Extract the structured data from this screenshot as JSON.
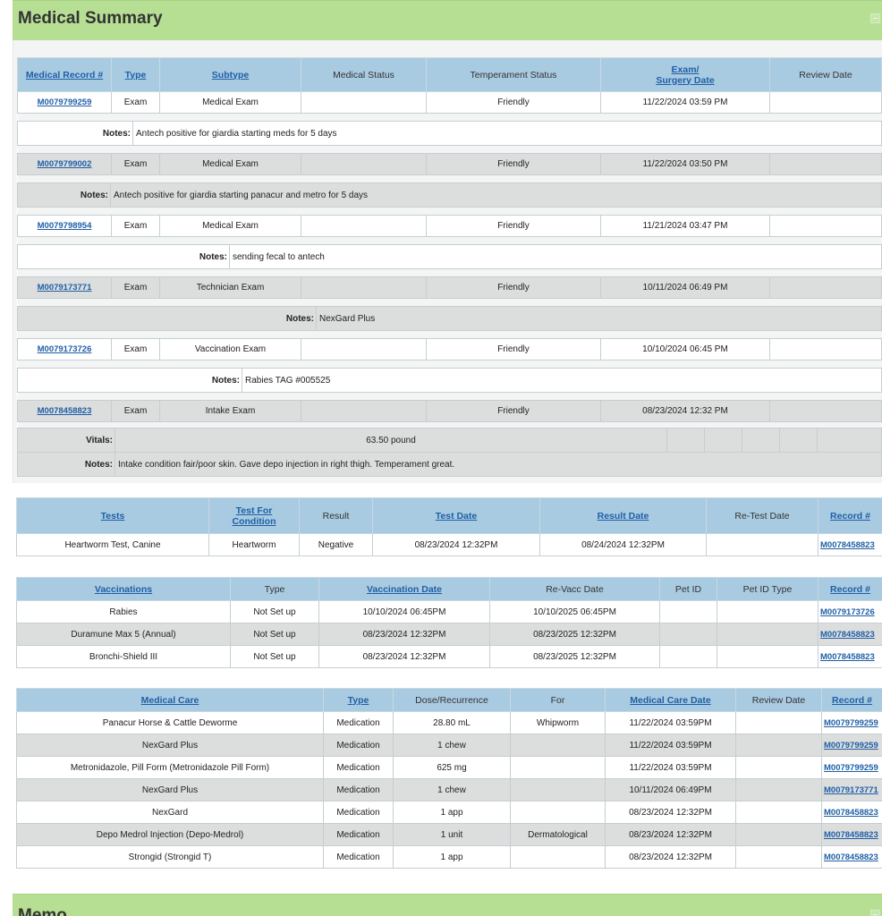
{
  "medical_summary": {
    "title": "Medical Summary",
    "headers": {
      "record": "Medical Record #",
      "type": "Type",
      "subtype": "Subtype",
      "medical_status": "Medical Status",
      "temperament_status": "Temperament Status",
      "exam_date_1": "Exam/",
      "exam_date_2": "Surgery Date",
      "review_date": "Review Date"
    },
    "notes_label": "Notes:",
    "vitals_label": "Vitals:",
    "records": [
      {
        "record": "M0079799259",
        "type": "Exam",
        "subtype": "Medical Exam",
        "medical_status": "",
        "temperament": "Friendly",
        "date": "11/22/2024 03:59 PM",
        "review": "",
        "notes": "Antech positive for giardia starting meds for 5 days"
      },
      {
        "record": "M0079799002",
        "type": "Exam",
        "subtype": "Medical Exam",
        "medical_status": "",
        "temperament": "Friendly",
        "date": "11/22/2024 03:50 PM",
        "review": "",
        "notes": "Antech positive for giardia starting panacur and metro for 5 days"
      },
      {
        "record": "M0079798954",
        "type": "Exam",
        "subtype": "Medical Exam",
        "medical_status": "",
        "temperament": "Friendly",
        "date": "11/21/2024 03:47 PM",
        "review": "",
        "notes": "sending fecal to antech"
      },
      {
        "record": "M0079173771",
        "type": "Exam",
        "subtype": "Technician Exam",
        "medical_status": "",
        "temperament": "Friendly",
        "date": "10/11/2024 06:49 PM",
        "review": "",
        "notes": "NexGard Plus"
      },
      {
        "record": "M0079173726",
        "type": "Exam",
        "subtype": "Vaccination Exam",
        "medical_status": "",
        "temperament": "Friendly",
        "date": "10/10/2024 06:45 PM",
        "review": "",
        "notes": "Rabies TAG #005525"
      },
      {
        "record": "M0078458823",
        "type": "Exam",
        "subtype": "Intake Exam",
        "medical_status": "",
        "temperament": "Friendly",
        "date": "08/23/2024 12:32 PM",
        "review": "",
        "vitals": "63.50 pound",
        "notes": "Intake condition fair/poor skin. Gave depo injection in right thigh. Temperament great."
      }
    ]
  },
  "tests": {
    "headers": {
      "tests": "Tests",
      "condition_1": "Test For",
      "condition_2": "Condition",
      "result": "Result",
      "test_date": "Test Date",
      "result_date": "Result Date",
      "retest": "Re-Test Date",
      "record": "Record #"
    },
    "rows": [
      {
        "test": "Heartworm Test, Canine",
        "condition": "Heartworm",
        "result": "Negative",
        "test_date": "08/23/2024 12:32PM",
        "result_date": "08/24/2024 12:32PM",
        "retest": "",
        "record": "M0078458823"
      }
    ]
  },
  "vaccinations": {
    "headers": {
      "vaccinations": "Vaccinations",
      "type": "Type",
      "vacc_date": "Vaccination Date",
      "revacc": "Re-Vacc Date",
      "pet_id": "Pet ID",
      "pet_id_type": "Pet ID Type",
      "record": "Record #"
    },
    "rows": [
      {
        "name": "Rabies",
        "type": "Not Set up",
        "date": "10/10/2024 06:45PM",
        "revacc": "10/10/2025 06:45PM",
        "pet_id": "",
        "pet_id_type": "",
        "record": "M0079173726"
      },
      {
        "name": "Duramune Max 5 (Annual)",
        "type": "Not Set up",
        "date": "08/23/2024 12:32PM",
        "revacc": "08/23/2025 12:32PM",
        "pet_id": "",
        "pet_id_type": "",
        "record": "M0078458823"
      },
      {
        "name": "Bronchi-Shield III",
        "type": "Not Set up",
        "date": "08/23/2024 12:32PM",
        "revacc": "08/23/2025 12:32PM",
        "pet_id": "",
        "pet_id_type": "",
        "record": "M0078458823"
      }
    ]
  },
  "medical_care": {
    "headers": {
      "care": "Medical Care",
      "type": "Type",
      "dose": "Dose/Recurrence",
      "for": "For",
      "date": "Medical Care Date",
      "review": "Review Date",
      "record": "Record #"
    },
    "rows": [
      {
        "care": "Panacur Horse & Cattle Deworme",
        "type": "Medication",
        "dose": "28.80 mL",
        "for": "Whipworm",
        "date": "11/22/2024 03:59PM",
        "review": "",
        "record": "M0079799259"
      },
      {
        "care": "NexGard Plus",
        "type": "Medication",
        "dose": "1 chew",
        "for": "",
        "date": "11/22/2024 03:59PM",
        "review": "",
        "record": "M0079799259"
      },
      {
        "care": "Metronidazole, Pill Form (Metronidazole Pill Form)",
        "type": "Medication",
        "dose": "625 mg",
        "for": "",
        "date": "11/22/2024 03:59PM",
        "review": "",
        "record": "M0079799259"
      },
      {
        "care": "NexGard Plus",
        "type": "Medication",
        "dose": "1 chew",
        "for": "",
        "date": "10/11/2024 06:49PM",
        "review": "",
        "record": "M0079173771"
      },
      {
        "care": "NexGard",
        "type": "Medication",
        "dose": "1 app",
        "for": "",
        "date": "08/23/2024 12:32PM",
        "review": "",
        "record": "M0078458823"
      },
      {
        "care": "Depo Medrol Injection (Depo-Medrol)",
        "type": "Medication",
        "dose": "1 unit",
        "for": "Dermatological",
        "date": "08/23/2024 12:32PM",
        "review": "",
        "record": "M0078458823"
      },
      {
        "care": "Strongid (Strongid T)",
        "type": "Medication",
        "dose": "1 app",
        "for": "",
        "date": "08/23/2024 12:32PM",
        "review": "",
        "record": "M0078458823"
      }
    ]
  },
  "memo": {
    "title": "Memo"
  },
  "colors": {
    "section_header": "#b7df94",
    "table_header": "#a9cbe2",
    "link": "#1f5fa6",
    "alt_row": "#dcdddd"
  }
}
